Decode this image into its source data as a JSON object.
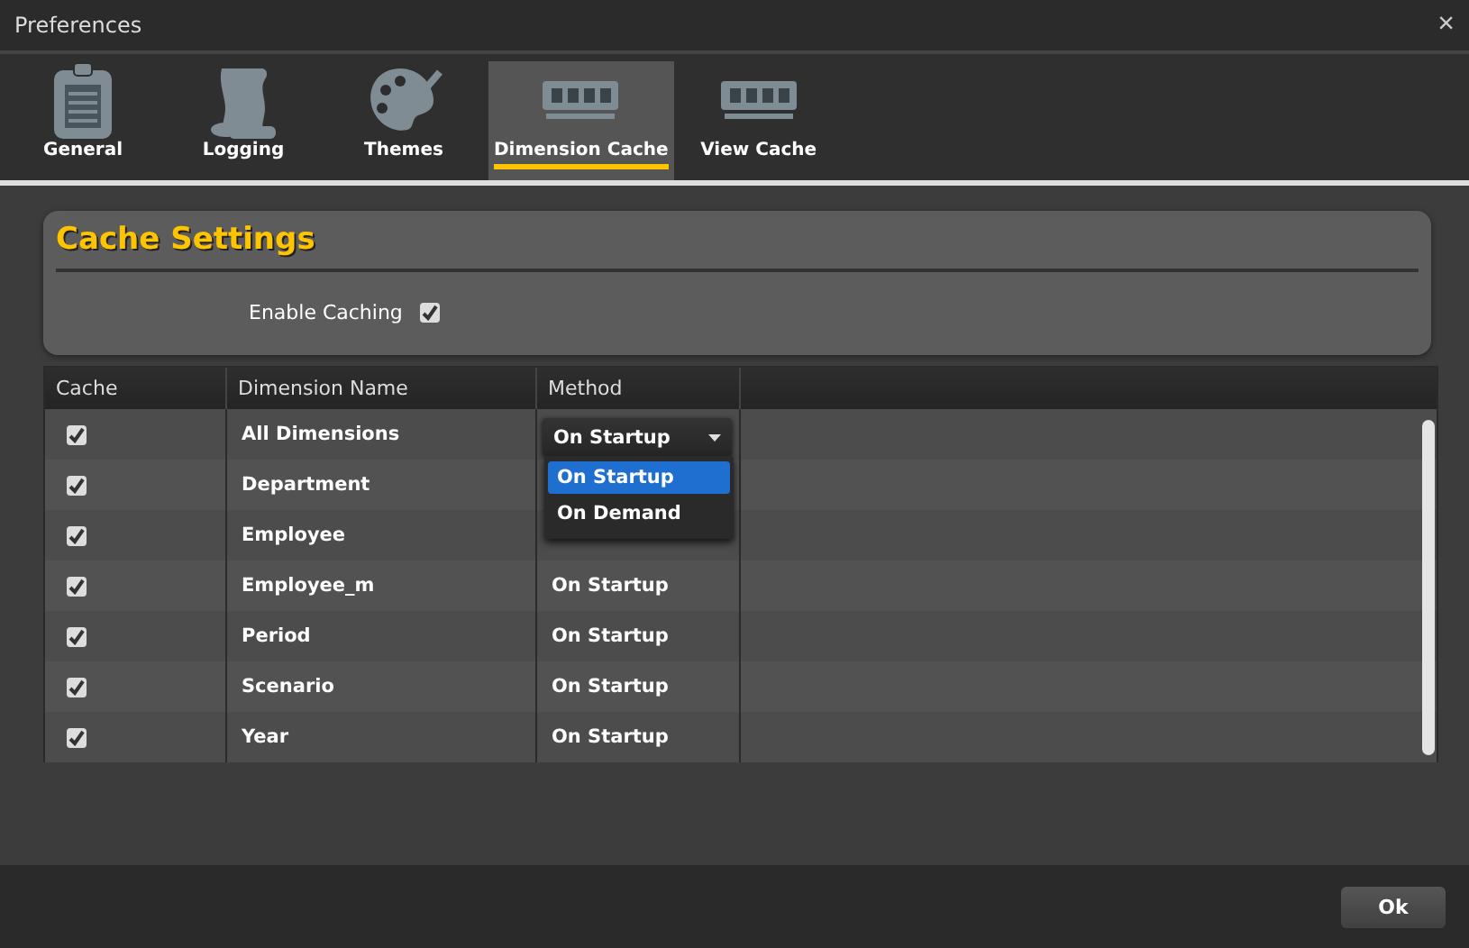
{
  "window": {
    "title": "Preferences",
    "close": "×"
  },
  "tabs": [
    {
      "label": "General",
      "selected": false
    },
    {
      "label": "Logging",
      "selected": false
    },
    {
      "label": "Themes",
      "selected": false
    },
    {
      "label": "Dimension Cache",
      "selected": true
    },
    {
      "label": "View Cache",
      "selected": false
    }
  ],
  "panel": {
    "title": "Cache Settings",
    "enable_label": "Enable Caching",
    "enable_checked": true
  },
  "table": {
    "columns": [
      "Cache",
      "Dimension Name",
      "Method"
    ],
    "rows": [
      {
        "checked": true,
        "name": "All Dimensions",
        "method": "On Startup"
      },
      {
        "checked": true,
        "name": "Department"
      },
      {
        "checked": true,
        "name": "Employee"
      },
      {
        "checked": true,
        "name": "Employee_m",
        "method": "On Startup"
      },
      {
        "checked": true,
        "name": "Period",
        "method": "On Startup"
      },
      {
        "checked": true,
        "name": "Scenario",
        "method": "On Startup"
      },
      {
        "checked": true,
        "name": "Year",
        "method": "On Startup"
      }
    ]
  },
  "dropdown": {
    "options": [
      {
        "label": "On Startup",
        "selected": true
      },
      {
        "label": "On Demand",
        "selected": false
      }
    ]
  },
  "buttons": [
    "Ok"
  ]
}
